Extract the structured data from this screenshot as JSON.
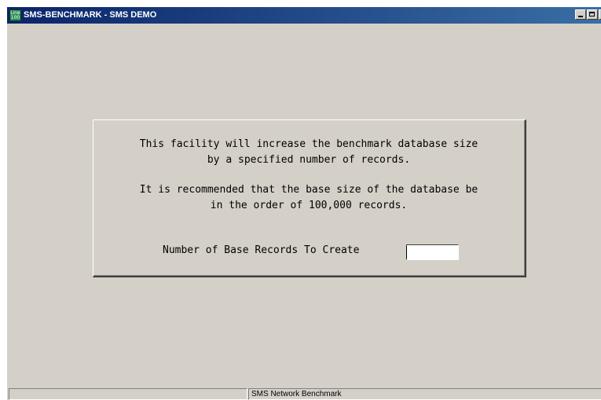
{
  "window": {
    "title": "SMS-BENCHMARK - SMS DEMO",
    "app_icon": "line100-icon",
    "app_icon_text": "Line 100",
    "icon_color": "#2e8b57",
    "titlebar_color": "#0a246a"
  },
  "dialog": {
    "message_line1": "This facility will increase the benchmark database size",
    "message_line2": "by a specified number of records.",
    "message_line3": "It is recommended that the base size of the database be",
    "message_line4": "in the order of 100,000 records.",
    "field_label": "Number of Base Records To Create",
    "field_value": ""
  },
  "statusbar": {
    "pane1": "",
    "pane2": "SMS Network Benchmark"
  }
}
